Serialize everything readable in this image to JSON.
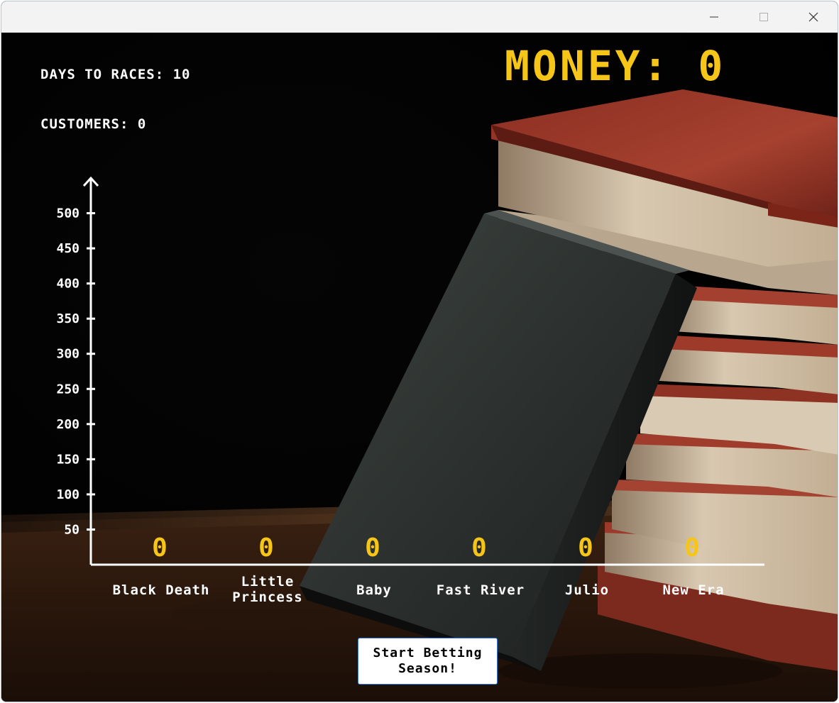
{
  "window": {
    "controls": {
      "minimize_icon": "minimize-icon",
      "maximize_icon": "maximize-icon",
      "close_icon": "close-icon"
    }
  },
  "hud": {
    "days_to_races": "DAYS TO RACES: 10",
    "customers": "CUSTOMERS: 0",
    "money": "MONEY: 0"
  },
  "colors": {
    "money_yellow": "#f5c518",
    "axis_white": "#ffffff",
    "background": "#000000"
  },
  "chart_data": {
    "type": "bar",
    "categories": [
      "Black Death",
      "Little\nPrincess",
      "Baby",
      "Fast River",
      "Julio",
      "New Era"
    ],
    "values": [
      0,
      0,
      0,
      0,
      0,
      0
    ],
    "value_labels": [
      "0",
      "0",
      "0",
      "0",
      "0",
      "0"
    ],
    "y_ticks": [
      50,
      100,
      150,
      200,
      250,
      300,
      350,
      400,
      450,
      500
    ],
    "ylim": [
      0,
      550
    ],
    "title": "",
    "xlabel": "",
    "ylabel": "",
    "grid": false
  },
  "actions": {
    "start_button": "Start Betting\nSeason!"
  }
}
